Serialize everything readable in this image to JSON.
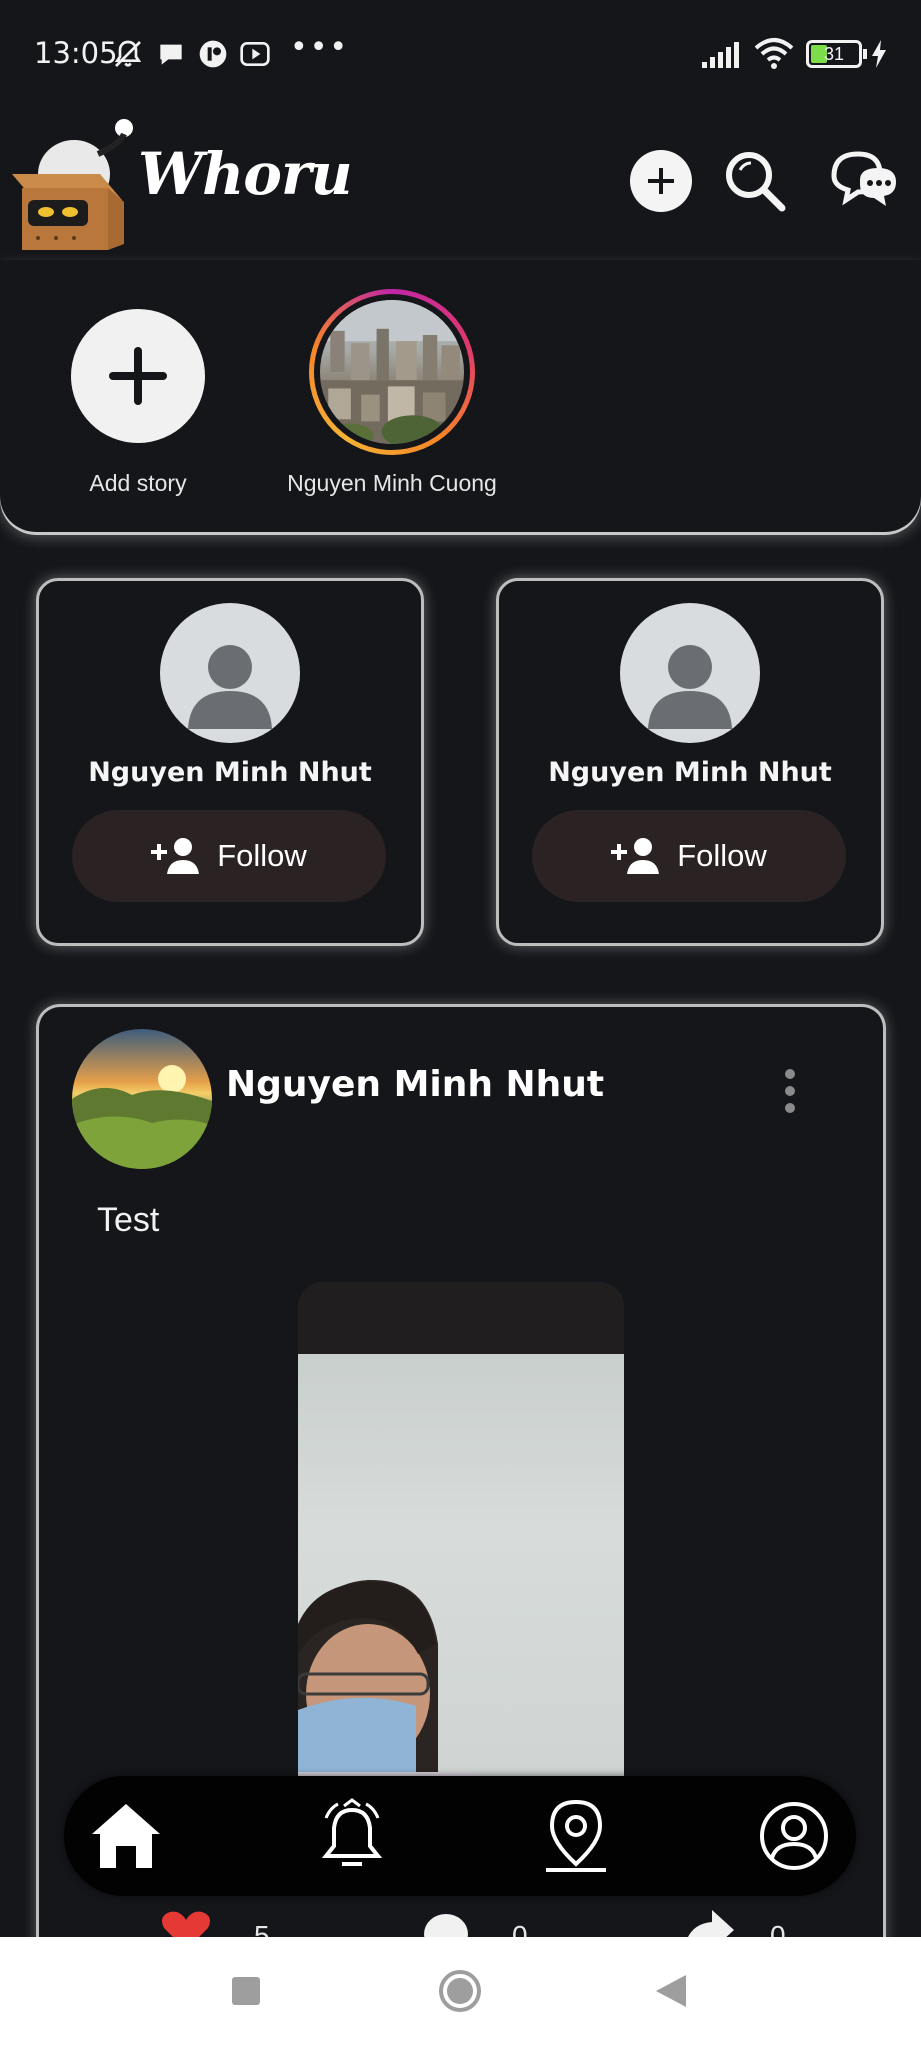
{
  "status_bar": {
    "time": "13:05",
    "battery": "31"
  },
  "header": {
    "app_name": "Whoru",
    "icons": [
      "add-icon",
      "search-icon",
      "chat-icon"
    ]
  },
  "stories": {
    "add_label": "Add story",
    "items": [
      {
        "name": "Nguyen Minh Cuong"
      }
    ]
  },
  "suggestions": [
    {
      "name": "Nguyen Minh Nhut",
      "button": "Follow"
    },
    {
      "name": "Nguyen Minh Nhut",
      "button": "Follow"
    }
  ],
  "post": {
    "author": "Nguyen Minh Nhut",
    "text": "Test",
    "likes": "5",
    "comments": "0",
    "shares": "0"
  },
  "bottom_nav": {
    "items": [
      "home-icon",
      "bell-icon",
      "location-icon",
      "profile-icon"
    ],
    "active": "home-icon"
  },
  "colors": {
    "background": "#14161a",
    "follow_button": "#2a2223",
    "nav_bar": "#020203",
    "like_red": "#e53935"
  }
}
